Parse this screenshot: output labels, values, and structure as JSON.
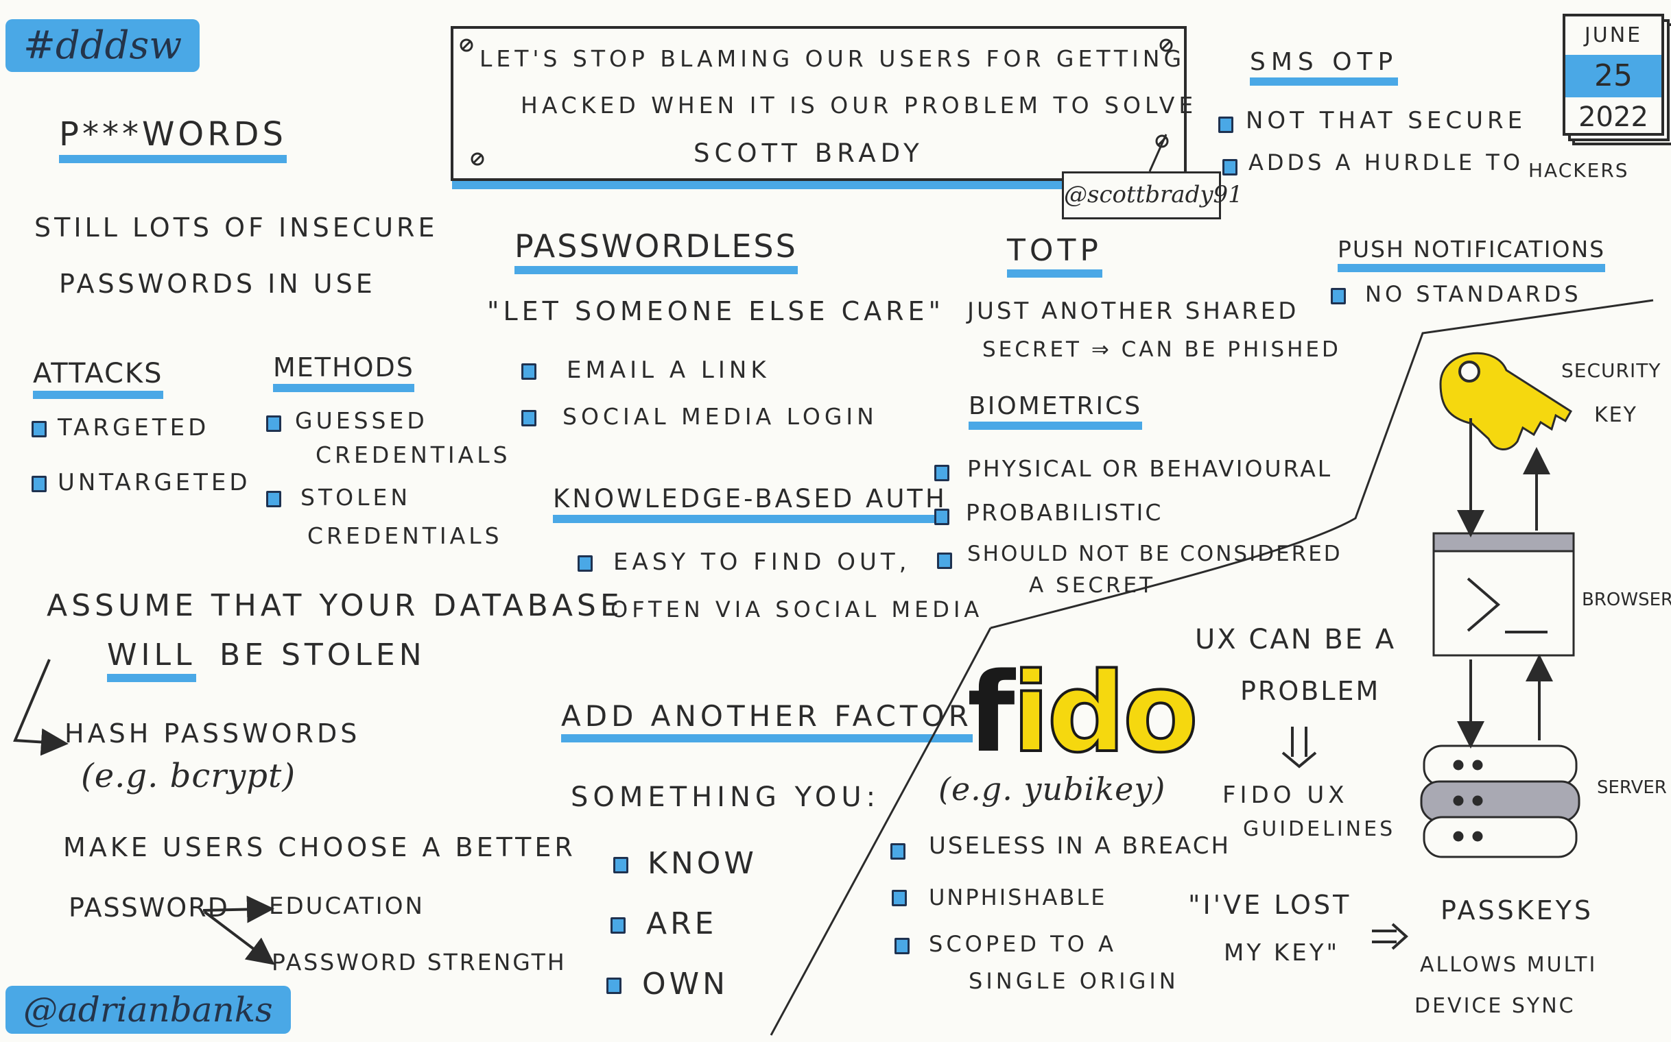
{
  "tags": {
    "event": "#dddsw",
    "author": "@adrianbanks"
  },
  "date": {
    "month": "June",
    "day": "25",
    "year": "2022"
  },
  "talk": {
    "title_line1": "Let's stop blaming our users for getting",
    "title_line2": "hacked when it is our problem to solve",
    "speaker": "Scott Brady",
    "handle": "@scottbrady91"
  },
  "passwords": {
    "heading": "P***words",
    "note_line1": "Still lots of insecure",
    "note_line2": "passwords in use"
  },
  "attacks": {
    "heading": "Attacks",
    "items": [
      "Targeted",
      "Untargeted"
    ]
  },
  "methods": {
    "heading": "Methods",
    "items": [
      {
        "line1": "Guessed",
        "line2": "credentials"
      },
      {
        "line1": "Stolen",
        "line2": "credentials"
      }
    ]
  },
  "database": {
    "line1": "Assume that your database",
    "will": "will",
    "be_stolen": "be stolen",
    "hash_line1": "Hash passwords",
    "hash_line2": "(e.g. bcrypt)",
    "choose_line1": "Make users choose a better",
    "choose_word": "password",
    "education": "Education",
    "strength": "password strength"
  },
  "passwordless": {
    "heading": "Passwordless",
    "quote": "\"Let someone else care\"",
    "items": [
      "Email a link",
      "Social media login"
    ]
  },
  "kba": {
    "heading": "Knowledge-based auth",
    "line1": "Easy to find out,",
    "line2": "often via social media"
  },
  "factor": {
    "heading": "Add another factor",
    "sub": "Something you:",
    "items": [
      "Know",
      "Are",
      "Own"
    ]
  },
  "totp": {
    "heading": "TOTP",
    "line1": "Just another shared",
    "line2": "secret ⇒ can be phished"
  },
  "biometrics": {
    "heading": "Biometrics",
    "items": [
      "Physical or behavioural",
      "Probabilistic",
      "Should not be considered"
    ],
    "item3_line2": "a secret"
  },
  "sms": {
    "heading": "SMS OTP",
    "items": [
      "Not that secure",
      "Adds a hurdle to"
    ],
    "hackers": "hackers"
  },
  "push": {
    "heading": "Push notifications",
    "items": [
      "No standards"
    ]
  },
  "diagram": {
    "key_label_line1": "Security",
    "key_label_line2": "key",
    "browser_label": "Browser",
    "server_label": "Server"
  },
  "fido": {
    "logo_f": "f",
    "logo_ido": "ido",
    "example": "(e.g. yubikey)",
    "items": [
      "Useless in a breach",
      "Unphishable",
      "Scoped to a"
    ],
    "item3_line2": "single origin",
    "ux_line1": "UX can be a",
    "ux_line2": "problem",
    "guidelines_line1": "Fido UX",
    "guidelines_line2": "guidelines",
    "lost_line1": "\"I've lost",
    "lost_line2": "my key\"",
    "passkeys": "Passkeys",
    "passkeys_line1": "Allows multi",
    "passkeys_line2": "device sync"
  }
}
